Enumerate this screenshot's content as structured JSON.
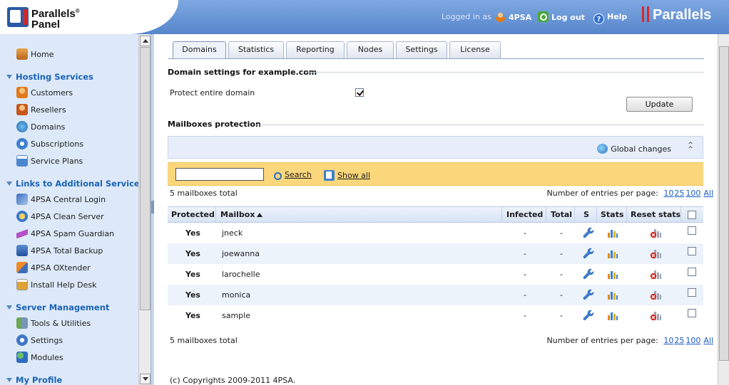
{
  "header": {
    "logo_line1": "Parallels",
    "logo_reg": "®",
    "logo_line2": "Panel",
    "logged_in_as": "Logged in as",
    "user": "4PSA",
    "logout": "Log out",
    "help": "Help",
    "brand": "Parallels"
  },
  "sidebar": {
    "home": "Home",
    "hosting_services": "Hosting Services",
    "customers": "Customers",
    "resellers": "Resellers",
    "domains": "Domains",
    "subscriptions": "Subscriptions",
    "service_plans": "Service Plans",
    "links_additional": "Links to Additional Services",
    "central_login": "4PSA Central Login",
    "clean_server": "4PSA Clean Server",
    "spam_guardian": "4PSA Spam Guardian",
    "total_backup": "4PSA Total Backup",
    "oxtender": "4PSA OXtender",
    "help_desk": "Install Help Desk",
    "server_management": "Server Management",
    "tools": "Tools & Utilities",
    "settings": "Settings",
    "modules": "Modules",
    "my_profile": "My Profile"
  },
  "tabs": [
    "Domains",
    "Statistics",
    "Reporting",
    "Nodes",
    "Settings",
    "License"
  ],
  "domain_settings": {
    "title": "Domain settings for example.com",
    "protect_label": "Protect entire domain",
    "protect_checked": true,
    "update_button": "Update"
  },
  "mailboxes": {
    "title": "Mailboxes protection",
    "global_changes": "Global changes",
    "search_value": "",
    "search_label": "Search",
    "show_all_label": "Show all",
    "total_text": "5 mailboxes total",
    "per_page_label": "Number of entries per page:",
    "per_page_options": [
      "10",
      "25",
      "100",
      "All"
    ],
    "columns": {
      "protected": "Protected",
      "mailbox": "Mailbox",
      "infected": "Infected",
      "total": "Total",
      "s": "S",
      "stats": "Stats",
      "reset_stats": "Reset stats"
    },
    "rows": [
      {
        "protected": "Yes",
        "mailbox": "jneck",
        "infected": "-",
        "total": "-"
      },
      {
        "protected": "Yes",
        "mailbox": "joewanna",
        "infected": "-",
        "total": "-"
      },
      {
        "protected": "Yes",
        "mailbox": "larochelle",
        "infected": "-",
        "total": "-"
      },
      {
        "protected": "Yes",
        "mailbox": "monica",
        "infected": "-",
        "total": "-"
      },
      {
        "protected": "Yes",
        "mailbox": "sample",
        "infected": "-",
        "total": "-"
      }
    ]
  },
  "footer": "(c) Copyrights 2009-2011 4PSA.",
  "colors": {
    "header_blue": "#5686cc",
    "sidebar_bg": "#dde9f8",
    "section_blue": "#1a63b8",
    "search_bar": "#fbd77b",
    "link_blue": "#1a5cc0"
  }
}
